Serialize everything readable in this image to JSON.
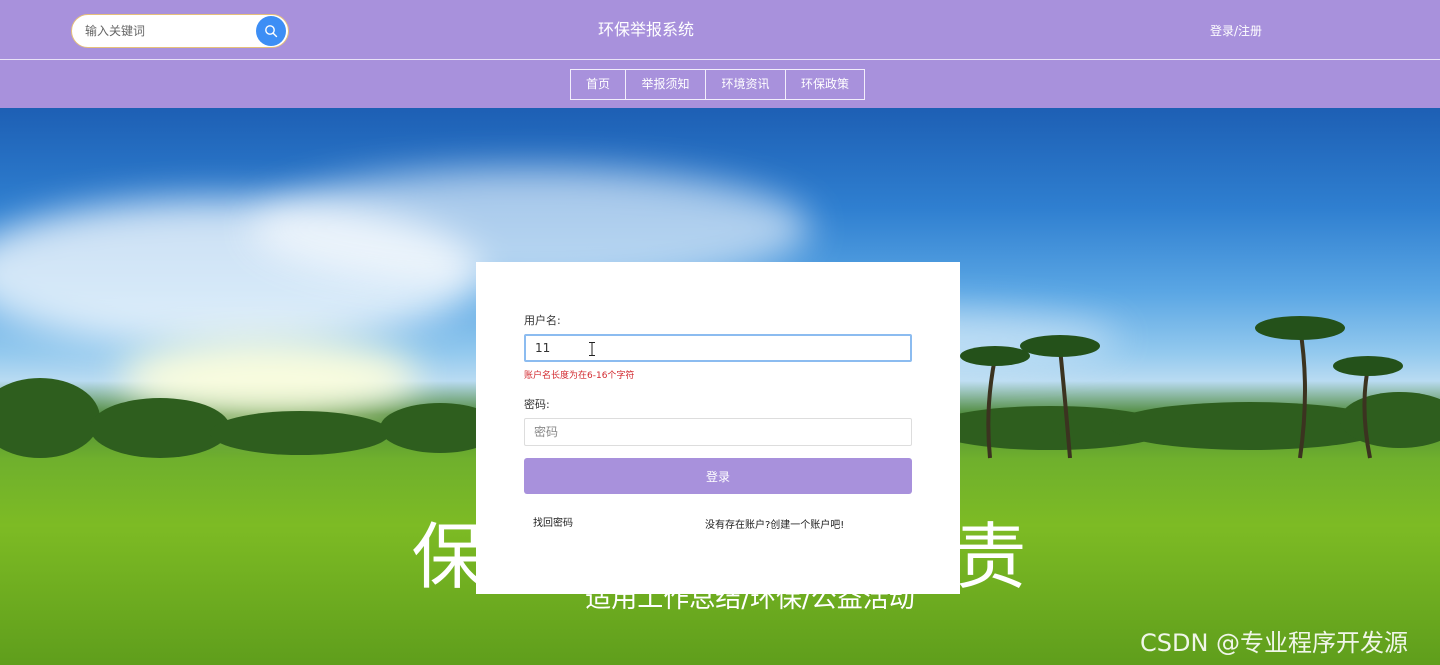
{
  "header": {
    "search_placeholder": "输入关键词",
    "site_title": "环保举报系统",
    "login_register": "登录/注册"
  },
  "nav": {
    "items": [
      {
        "label": "首页"
      },
      {
        "label": "举报须知"
      },
      {
        "label": "环境资讯"
      },
      {
        "label": "环保政策"
      }
    ]
  },
  "hero": {
    "slogan": "保护环境 人人有责",
    "subslogan": "适用工作总结/环保/公益活动"
  },
  "login": {
    "username_label": "用户名:",
    "username_value": "11",
    "username_error": "账户名长度为在6-16个字符",
    "password_label": "密码:",
    "password_placeholder": "密码",
    "login_button": "登录",
    "forgot_password": "找回密码",
    "register_prompt": "没有存在账户?创建一个账户吧!"
  },
  "watermark": "CSDN @专业程序开发源",
  "colors": {
    "header_bg": "#a891dc",
    "search_button": "#3d8ef5",
    "error": "#d2282e"
  },
  "icons": {
    "search": "search-icon"
  }
}
